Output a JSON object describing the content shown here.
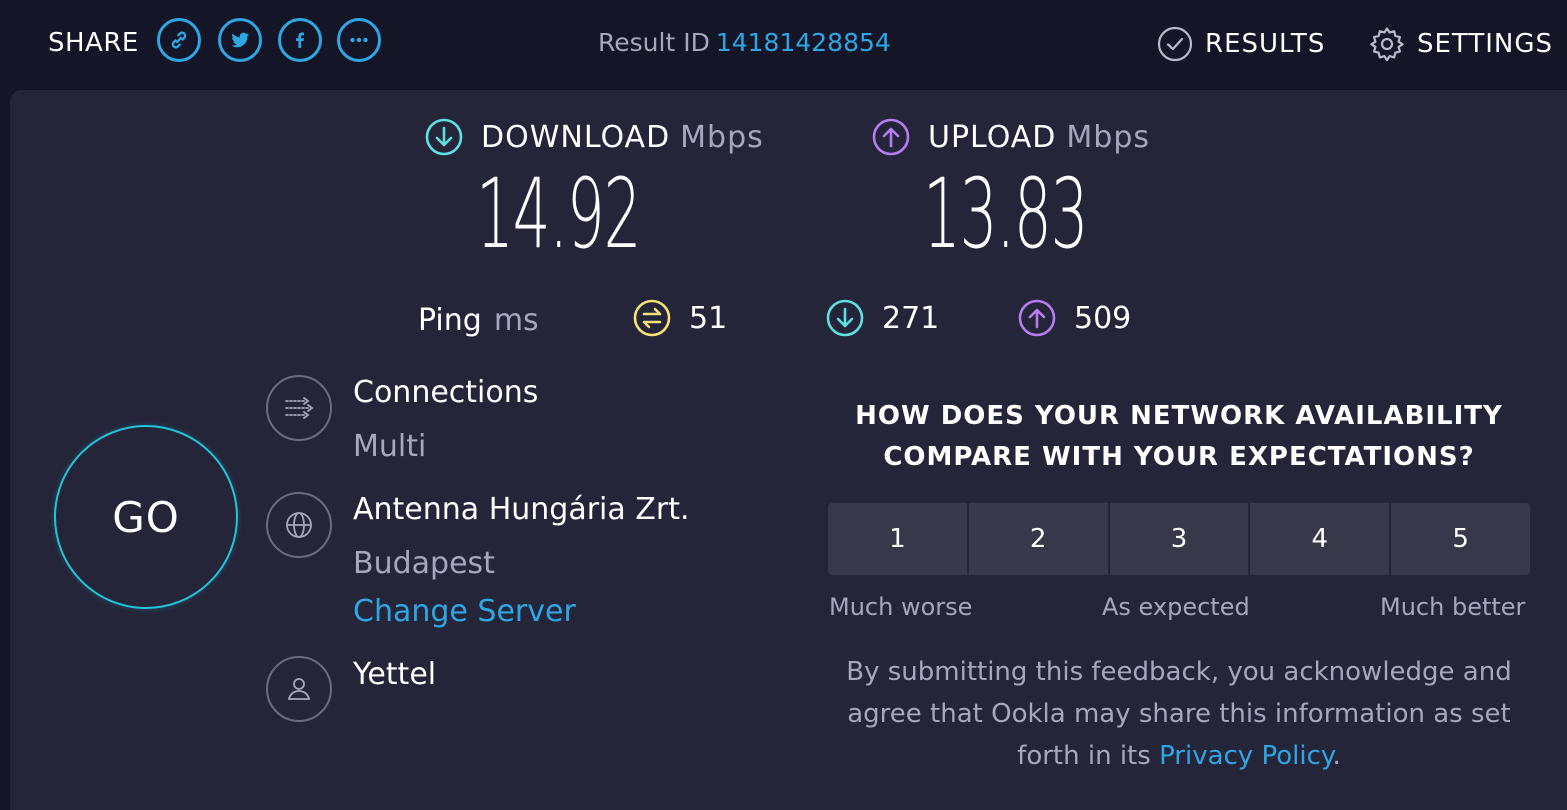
{
  "header": {
    "share_label": "SHARE",
    "share_icons": [
      "link-icon",
      "twitter-icon",
      "facebook-icon",
      "more-icon"
    ],
    "result_id_label": "Result ID",
    "result_id_value": "14181428854",
    "results_label": "RESULTS",
    "settings_label": "SETTINGS"
  },
  "download": {
    "label": "DOWNLOAD",
    "unit": "Mbps",
    "value": "14.92"
  },
  "upload": {
    "label": "UPLOAD",
    "unit": "Mbps",
    "value": "13.83"
  },
  "ping": {
    "label": "Ping",
    "unit": "ms",
    "idle": "51",
    "download": "271",
    "upload": "509"
  },
  "go_label": "GO",
  "connections": {
    "title": "Connections",
    "value": "Multi"
  },
  "server": {
    "name": "Antenna Hungária Zrt.",
    "location": "Budapest",
    "change_label": "Change Server"
  },
  "provider": {
    "name": "Yettel"
  },
  "feedback": {
    "question_line1": "HOW DOES YOUR NETWORK AVAILABILITY",
    "question_line2": "COMPARE WITH YOUR EXPECTATIONS?",
    "ratings": [
      "1",
      "2",
      "3",
      "4",
      "5"
    ],
    "scale_low": "Much worse",
    "scale_mid": "As expected",
    "scale_high": "Much better",
    "disclaimer_text": "By submitting this feedback, you acknowledge and agree that Ookla may share this information as set forth in its ",
    "privacy_link": "Privacy Policy",
    "disclaimer_end": "."
  },
  "colors": {
    "accent_blue": "#2fa6e4",
    "download_cyan": "#5fe0e0",
    "upload_purple": "#b77cf2",
    "ping_yellow": "#f5e07a",
    "background": "#141526",
    "panel": "#242539"
  }
}
